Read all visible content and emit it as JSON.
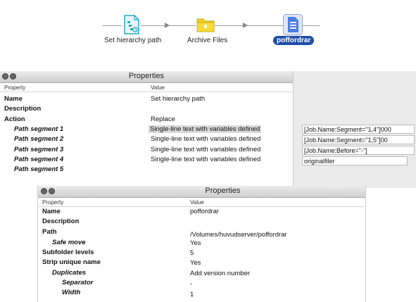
{
  "flow": {
    "nodes": [
      {
        "label": "Set hierarchy path",
        "icon": "hierarchy-path-icon"
      },
      {
        "label": "Archive Files",
        "icon": "archive-folder-icon"
      },
      {
        "label": "poffordrar",
        "icon": "document-icon",
        "selected": true
      }
    ]
  },
  "panel1": {
    "title": "Properties",
    "col_property": "Property",
    "col_value": "Value",
    "rows": [
      {
        "property": "Name",
        "value": "Set hierarchy path"
      },
      {
        "property": "Description",
        "value": ""
      },
      {
        "property": "Action",
        "value": "Replace"
      },
      {
        "property": "Path segment 1",
        "value": "Single-line text with variables defined"
      },
      {
        "property": "Path segment 2",
        "value": "Single-line text with variables defined"
      },
      {
        "property": "Path segment 3",
        "value": "Single-line text with variables defined"
      },
      {
        "property": "Path segment 4",
        "value": "Single-line text with variables defined"
      },
      {
        "property": "Path segment 5",
        "value": ""
      }
    ],
    "fields": [
      "[Job.Name:Segment=\"1,4\"]000",
      "[Job.Name:Segment=\"1,5\"]00",
      "[Job.Name:Before=\"-\"]",
      "originalfiler"
    ]
  },
  "panel2": {
    "title": "Properties",
    "col_property": "Property",
    "col_value": "Value",
    "rows": [
      {
        "property": "Name",
        "value": "poffordrar"
      },
      {
        "property": "Description",
        "value": ""
      },
      {
        "property": "Path",
        "value": "/Volumes/huvudserver/poffordrar"
      },
      {
        "property": "Safe move",
        "value": "Yes"
      },
      {
        "property": "Subfolder levels",
        "value": "5"
      },
      {
        "property": "Strip unique name",
        "value": "Yes"
      },
      {
        "property": "Duplicates",
        "value": "Add version number"
      },
      {
        "property": "Separator",
        "value": "-"
      },
      {
        "property": "Width",
        "value": "1"
      }
    ]
  },
  "colors": {
    "selected_label_bg": "#1f4ea8",
    "icon_teal": "#2aa7c9",
    "folder_yellow": "#f2d21b",
    "doc_blue": "#4c7de0"
  }
}
